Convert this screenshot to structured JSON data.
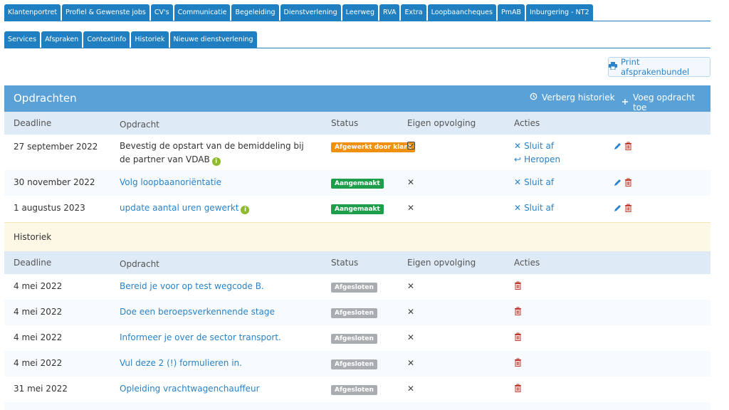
{
  "tabs_top": [
    "Klantenportret",
    "Profiel & Gewenste jobs",
    "CV's",
    "Communicatie",
    "Begeleiding",
    "Dienstverlening",
    "Leerweg",
    "RVA",
    "Extra",
    "Loopbaancheques",
    "PmAB",
    "Inburgering - NT2"
  ],
  "tabs_sub": [
    "Services",
    "Afspraken",
    "Contextinfo",
    "Historiek",
    "Nieuwe dienstverlening"
  ],
  "print_label": "Print afsprakenbundel",
  "panel": {
    "title": "Opdrachten",
    "hide_history_label": "Verberg historiek",
    "add_label": "Voeg opdracht toe"
  },
  "columns": {
    "deadline": "Deadline",
    "opdracht": "Opdracht",
    "status": "Status",
    "eigen": "Eigen opvolging",
    "acties": "Acties"
  },
  "rows": [
    {
      "deadline": "27 september 2022",
      "opdracht": "Bevestig de opstart van de bemiddeling bij de partner van VDAB",
      "status": "Afgewerkt door klant",
      "actions": [
        "Sluit af",
        "Heropen"
      ]
    },
    {
      "deadline": "30 november 2022",
      "opdracht": "Volg loopbaanoriëntatie",
      "status": "Aangemaakt",
      "actions": [
        "Sluit af"
      ]
    },
    {
      "deadline": "1 augustus 2023",
      "opdracht": "update aantal uren gewerkt",
      "status": "Aangemaakt",
      "actions": [
        "Sluit af"
      ]
    }
  ],
  "historiek_label": "Historiek",
  "history_rows": [
    {
      "deadline": "4 mei 2022",
      "opdracht": "Bereid je voor op test wegcode B.",
      "status": "Afgesloten"
    },
    {
      "deadline": "4 mei 2022",
      "opdracht": "Doe een beroepsverkennende stage",
      "status": "Afgesloten"
    },
    {
      "deadline": "4 mei 2022",
      "opdracht": "Informeer je over de sector transport.",
      "status": "Afgesloten"
    },
    {
      "deadline": "4 mei 2022",
      "opdracht": "Vul deze 2 (!) formulieren in.",
      "status": "Afgesloten"
    },
    {
      "deadline": "31 mei 2022",
      "opdracht": "Opleiding vrachtwagenchauffeur",
      "status": "Afgesloten"
    }
  ],
  "colors": {
    "tab": "#1f7fc0",
    "panel_header": "#5aa1d8",
    "link": "#2a82c9",
    "badge_orange": "#f0900f",
    "badge_green": "#1e9e4a",
    "badge_grey": "#a9adb1",
    "trash": "#c0392b"
  },
  "icons": {
    "print": "printer-icon",
    "history": "history-icon",
    "add": "plus-icon",
    "close": "x-icon",
    "reopen": "reply-icon",
    "edit": "pencil-icon",
    "delete": "trash-icon",
    "info": "info-icon",
    "checked": "checkbox-checked-icon"
  }
}
